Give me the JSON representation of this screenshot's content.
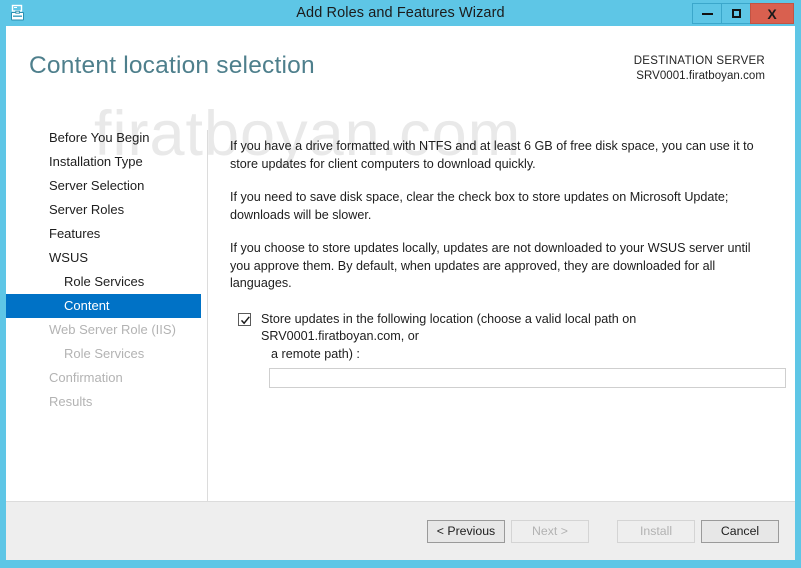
{
  "window": {
    "title": "Add Roles and Features Wizard",
    "app_icon": "server-wizard-icon",
    "controls": {
      "minimize": "minimize-icon",
      "maximize": "maximize-icon",
      "close_label": "X"
    },
    "frame_color": "#5ec6e6",
    "close_color": "#d9604f"
  },
  "header": {
    "page_title": "Content location selection",
    "destination_label": "DESTINATION SERVER",
    "destination_server": "SRV0001.firatboyan.com",
    "title_color": "#4e7f8c"
  },
  "watermark": {
    "text": "firatboyan.com"
  },
  "sidebar": {
    "selected_color": "#0072c6",
    "items": [
      {
        "label": "Before You Begin",
        "state": "normal",
        "level": 0
      },
      {
        "label": "Installation Type",
        "state": "normal",
        "level": 0
      },
      {
        "label": "Server Selection",
        "state": "normal",
        "level": 0
      },
      {
        "label": "Server Roles",
        "state": "normal",
        "level": 0
      },
      {
        "label": "Features",
        "state": "normal",
        "level": 0
      },
      {
        "label": "WSUS",
        "state": "normal",
        "level": 0
      },
      {
        "label": "Role Services",
        "state": "normal",
        "level": 1
      },
      {
        "label": "Content",
        "state": "selected",
        "level": 1
      },
      {
        "label": "Web Server Role (IIS)",
        "state": "disabled",
        "level": 0
      },
      {
        "label": "Role Services",
        "state": "disabled",
        "level": 1
      },
      {
        "label": "Confirmation",
        "state": "disabled",
        "level": 0
      },
      {
        "label": "Results",
        "state": "disabled",
        "level": 0
      }
    ]
  },
  "main": {
    "paragraph1": "If you have a drive formatted with NTFS and at least 6 GB of free disk space, you can use it to store updates for client computers to download quickly.",
    "paragraph2": "If you need to save disk space, clear the check box to store updates on Microsoft Update; downloads will be slower.",
    "paragraph3": "If you choose to store updates locally, updates are not downloaded to your WSUS server until you approve them. By default, when updates are approved, they are downloaded for all languages.",
    "checkbox": {
      "checked": true,
      "label_line1": "Store updates in the following location (choose a valid local path on SRV0001.firatboyan.com, or",
      "label_line2": "a remote path) :"
    },
    "path_input": {
      "value": "",
      "placeholder": ""
    }
  },
  "footer": {
    "buttons": [
      {
        "label": "< Previous",
        "enabled": true
      },
      {
        "label": "Next >",
        "enabled": false
      },
      {
        "label": "Install",
        "enabled": false
      },
      {
        "label": "Cancel",
        "enabled": true
      }
    ]
  }
}
